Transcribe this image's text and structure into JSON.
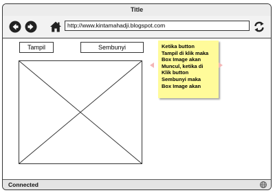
{
  "window": {
    "title": "Title"
  },
  "toolbar": {
    "back_icon": "arrow-left-circle",
    "forward_icon": "arrow-right-circle",
    "home_icon": "house",
    "url": "http://www.kintamahadji.blogspot.com",
    "refresh_icon": "refresh-arrows"
  },
  "content": {
    "show_button_label": "Tampil",
    "hide_button_label": "Sembunyi",
    "image_placeholder": "image-placeholder-x",
    "note_lines": [
      "Ketika button",
      "Tampil di klik maka",
      "Box Image akan",
      "Muncul, ketika di",
      "Klik button",
      "Sembunyi maka",
      "Box Image akan"
    ],
    "note_color": "#fffb9a",
    "arrow_color": "#f4b6b6"
  },
  "status": {
    "text": "Connected",
    "icon": "globe"
  }
}
